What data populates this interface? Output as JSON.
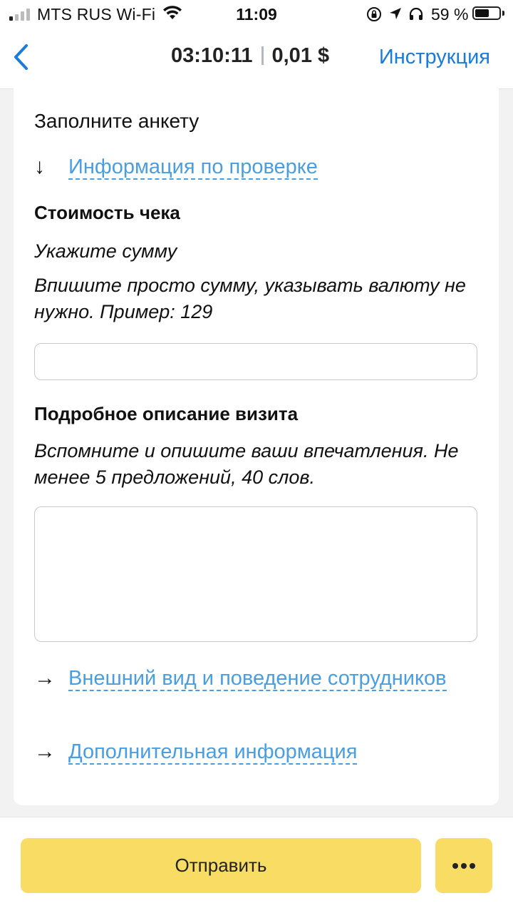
{
  "status_bar": {
    "carrier": "MTS RUS Wi-Fi",
    "time": "11:09",
    "battery_percent": "59 %",
    "battery_level": 0.59,
    "signal_bars_active": 1
  },
  "nav": {
    "timer": "03:10:11",
    "reward": "0,01 $",
    "instruction_label": "Инструкция",
    "accent_color": "#1a7bd9"
  },
  "form": {
    "title": "Заполните анкету",
    "info_link": {
      "arrow": "↓",
      "label": "Информация по проверке"
    },
    "check_cost": {
      "title": "Стоимость чека",
      "hint1": "Укажите сумму",
      "hint2": "Впишите просто сумму, указывать валюту не нужно. Пример: 129",
      "value": ""
    },
    "visit_description": {
      "title": "Подробное описание визита",
      "hint": "Вспомните и опишите ваши впечатления. Не менее 5 предложений, 40 слов.",
      "value": ""
    },
    "links": [
      {
        "arrow": "→",
        "label": "Внешний вид и поведение сотрудников"
      },
      {
        "arrow": "→",
        "label": "Дополнительная информация"
      }
    ]
  },
  "bottom": {
    "submit_label": "Отправить",
    "button_color": "#f8dc64"
  }
}
